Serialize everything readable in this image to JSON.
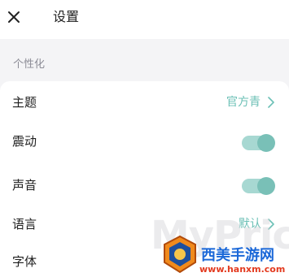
{
  "header": {
    "title": "设置",
    "close_icon": "close-icon"
  },
  "section": {
    "title": "个性化"
  },
  "settings": {
    "theme": {
      "label": "主题",
      "value": "官方青"
    },
    "vibration": {
      "label": "震动",
      "enabled": true
    },
    "sound": {
      "label": "声音",
      "enabled": true
    },
    "language": {
      "label": "语言",
      "value": "默认"
    },
    "font": {
      "label": "字体"
    }
  },
  "colors": {
    "accent": "#6cc0b6",
    "toggle_track": "#a7d8d2",
    "toggle_knob": "#79c0b7"
  },
  "watermark": {
    "text": "MyPrice",
    "logo_text": "西美手游网",
    "url": "www.hanxm.com"
  }
}
